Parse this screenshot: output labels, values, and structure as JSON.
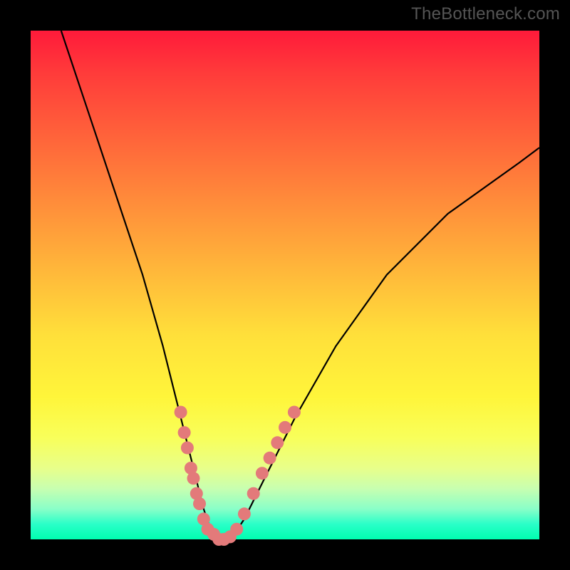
{
  "watermark": "TheBottleneck.com",
  "chart_data": {
    "type": "line",
    "title": "",
    "xlabel": "",
    "ylabel": "",
    "xlim": [
      0,
      100
    ],
    "ylim": [
      0,
      100
    ],
    "background_gradient_meaning": "red high / green low (bottleneck severity)",
    "series": [
      {
        "name": "bottleneck-curve",
        "x": [
          6,
          10,
          14,
          18,
          22,
          26,
          28,
          30,
          32,
          33,
          34,
          35,
          36,
          37,
          38,
          39,
          40,
          42,
          46,
          52,
          60,
          70,
          82,
          96,
          100
        ],
        "y": [
          100,
          88,
          76,
          64,
          52,
          38,
          30,
          22,
          14,
          10,
          6,
          3,
          1,
          0,
          0,
          0,
          1,
          4,
          12,
          24,
          38,
          52,
          64,
          74,
          77
        ]
      }
    ],
    "markers": {
      "name": "highlight-dots",
      "points": [
        {
          "x": 29.5,
          "y": 25
        },
        {
          "x": 30.2,
          "y": 21
        },
        {
          "x": 30.8,
          "y": 18
        },
        {
          "x": 31.5,
          "y": 14
        },
        {
          "x": 32.0,
          "y": 12
        },
        {
          "x": 32.6,
          "y": 9
        },
        {
          "x": 33.2,
          "y": 7
        },
        {
          "x": 34.0,
          "y": 4
        },
        {
          "x": 34.8,
          "y": 2
        },
        {
          "x": 36.0,
          "y": 1
        },
        {
          "x": 37.0,
          "y": 0
        },
        {
          "x": 38.0,
          "y": 0
        },
        {
          "x": 39.2,
          "y": 0.5
        },
        {
          "x": 40.5,
          "y": 2
        },
        {
          "x": 42.0,
          "y": 5
        },
        {
          "x": 43.8,
          "y": 9
        },
        {
          "x": 45.5,
          "y": 13
        },
        {
          "x": 47.0,
          "y": 16
        },
        {
          "x": 48.5,
          "y": 19
        },
        {
          "x": 50.0,
          "y": 22
        },
        {
          "x": 51.8,
          "y": 25
        }
      ]
    }
  }
}
